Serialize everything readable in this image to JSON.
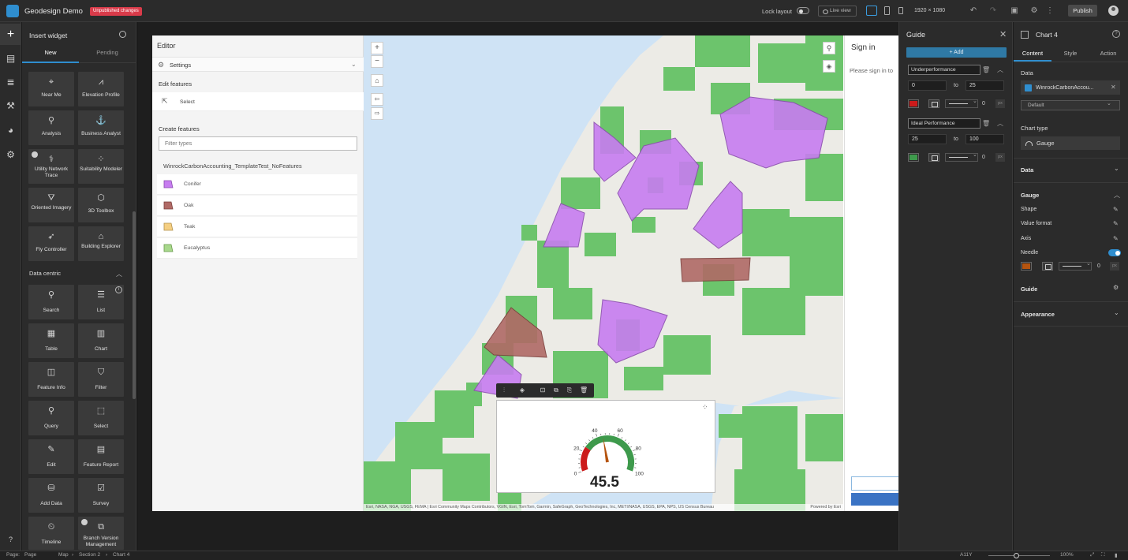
{
  "app": {
    "title": "Geodesign Demo",
    "unpublished_badge": "Unpublished changes",
    "lock_layout_label": "Lock layout",
    "live_view_label": "Live view",
    "resolution": "1920 × 1080",
    "publish_label": "Publish"
  },
  "insert_panel": {
    "title": "Insert widget",
    "tabs": [
      "New",
      "Pending"
    ],
    "tiles_top": [
      "Near Me",
      "Elevation Profile",
      "Analysis",
      "Business Analyst",
      "Utility Network Trace",
      "Suitability Modeler",
      "Oriented Imagery",
      "3D Toolbox",
      "Fly Controller",
      "Building Explorer"
    ],
    "section_data_centric": "Data centric",
    "tiles_data": [
      "Search",
      "List",
      "Table",
      "Chart",
      "Feature Info",
      "Filter",
      "Query",
      "Select",
      "Edit",
      "Feature Report",
      "Add Data",
      "Survey",
      "Timeline",
      "Branch Version Management"
    ]
  },
  "editor": {
    "title": "Editor",
    "settings_label": "Settings",
    "edit_features_title": "Edit features",
    "select_label": "Select",
    "create_features_title": "Create features",
    "filter_placeholder": "Filter types",
    "layer_name": "WinrockCarbonAccounting_TemplateTest_NoFeatures",
    "templates": [
      {
        "label": "Conifer",
        "color": "#c77df0"
      },
      {
        "label": "Oak",
        "color": "#b06a66"
      },
      {
        "label": "Teak",
        "color": "#f5cf82"
      },
      {
        "label": "Eucalyptus",
        "color": "#a8d88c"
      }
    ]
  },
  "map": {
    "attribution_left": "Esri, NASA, NGA, USGS, FEMA | Esri Community Maps Contributors, VGIN, Esri, TomTom, Garmin, SafeGraph, GeoTechnologies, Inc, METI/NASA, USGS, EPA, NPS, US Census Bureau",
    "attribution_right": "Powered by Esri",
    "colors": {
      "water": "#cfe3f5",
      "land": "#ecebe6",
      "vegetation": "#6cc46c",
      "conifer": "#c77df0",
      "oak": "#b06a66"
    }
  },
  "gauge": {
    "value_text": "45.5",
    "value": 45.5,
    "min": 0,
    "max": 100,
    "ticks": [
      "0",
      "20",
      "40",
      "60",
      "80",
      "100"
    ],
    "needle_color": "#b5540f"
  },
  "signin": {
    "title": "Sign in",
    "prompt": "Please sign in to"
  },
  "guide_panel": {
    "title": "Guide",
    "add_label": "Add",
    "to_label": "to",
    "guides": [
      {
        "name": "Underperformance",
        "from": "0",
        "to": "25",
        "color": "#cc1b1b",
        "width": "0"
      },
      {
        "name": "Ideal Performance",
        "from": "25",
        "to": "100",
        "color": "#3e9a4c",
        "width": "0"
      }
    ],
    "px_unit": "px"
  },
  "config_panel": {
    "title": "Chart 4",
    "tabs": [
      "Content",
      "Style",
      "Action"
    ],
    "data_label": "Data",
    "datasource_name": "WinrockCarbonAccou...",
    "datasource_view": "Default",
    "chart_type_label": "Chart type",
    "chart_type": "Gauge",
    "section_data": "Data",
    "section_gauge": "Gauge",
    "props": [
      "Shape",
      "Value format",
      "Axis",
      "Needle"
    ],
    "needle_color": "#b5540f",
    "needle_width": "0",
    "px_unit": "px",
    "section_guide": "Guide",
    "section_appearance": "Appearance"
  },
  "statusbar": {
    "page_label": "Page:",
    "page_value": "Page",
    "breadcrumb": [
      "Map",
      "Section 2",
      "Chart 4"
    ],
    "a11y": "A11Y",
    "zoom": "100%"
  }
}
